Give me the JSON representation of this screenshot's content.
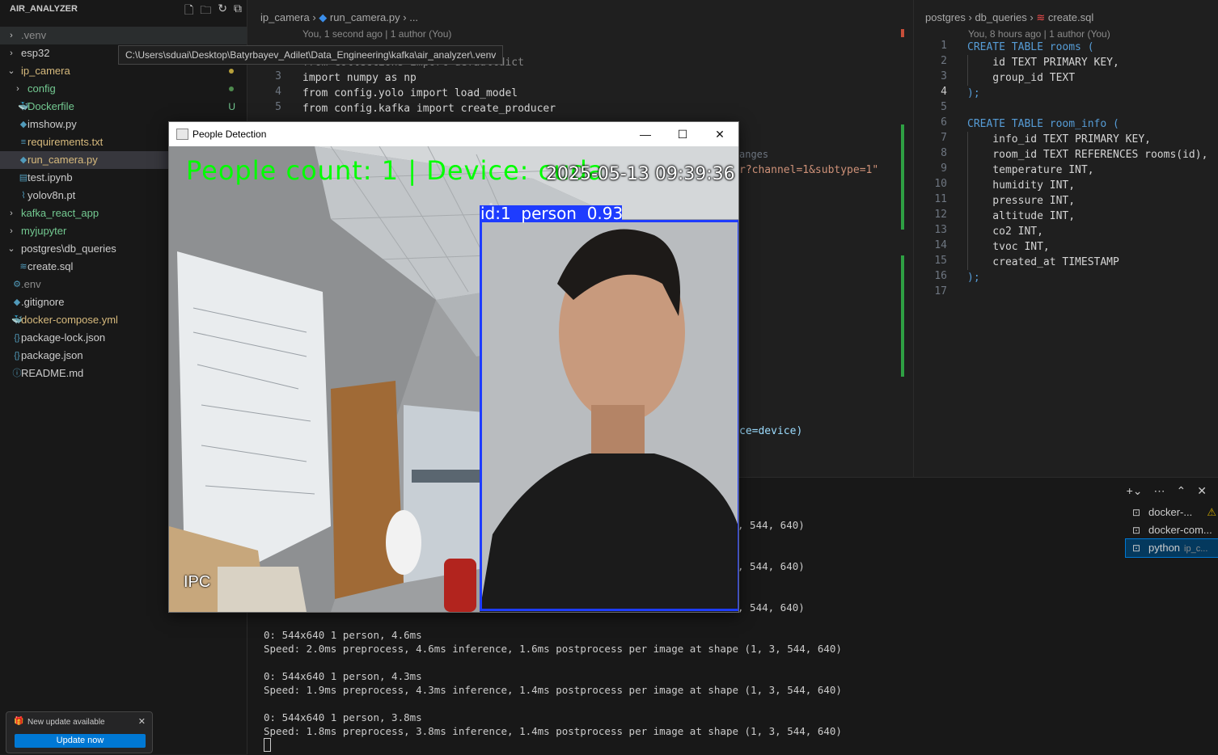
{
  "explorer": {
    "title": "AIR_ANALYZER",
    "tooltip": "C:\\Users\\sduai\\Desktop\\Batyrbayev_Adilet\\Data_Engineering\\kafka\\air_analyzer\\.venv",
    "items": [
      {
        "label": ".venv",
        "chev": "›",
        "icon": "",
        "badge": "",
        "color": "#8b8b8b"
      },
      {
        "label": "esp32",
        "chev": "›",
        "icon": "",
        "badge": "",
        "color": "#cccccc"
      },
      {
        "label": "ip_camera",
        "chev": "⌄",
        "icon": "",
        "badge": "",
        "color": "#d7ba7d"
      },
      {
        "label": "config",
        "chev": "›",
        "icon": "",
        "badge": "",
        "color": "#73c991"
      },
      {
        "label": "Dockerfile",
        "chev": "",
        "icon": "🐳",
        "badge": "U",
        "color": "#73c991"
      },
      {
        "label": "imshow.py",
        "chev": "",
        "icon": "◆",
        "badge": "",
        "color": "#cccccc"
      },
      {
        "label": "requirements.txt",
        "chev": "",
        "icon": "≡",
        "badge": "",
        "color": "#d7ba7d"
      },
      {
        "label": "run_camera.py",
        "chev": "",
        "icon": "◆",
        "badge": "",
        "color": "#d7ba7d"
      },
      {
        "label": "test.ipynb",
        "chev": "",
        "icon": "▤",
        "badge": "",
        "color": "#cccccc"
      },
      {
        "label": "yolov8n.pt",
        "chev": "",
        "icon": "⌇",
        "badge": "",
        "color": "#cccccc"
      },
      {
        "label": "kafka_react_app",
        "chev": "›",
        "icon": "",
        "badge": "",
        "color": "#73c991"
      },
      {
        "label": "myjupyter",
        "chev": "›",
        "icon": "",
        "badge": "",
        "color": "#73c991"
      },
      {
        "label": "postgres\\db_queries",
        "chev": "⌄",
        "icon": "",
        "badge": "",
        "color": "#cccccc"
      },
      {
        "label": "create.sql",
        "chev": "",
        "icon": "≋",
        "badge": "",
        "color": "#cccccc"
      },
      {
        "label": ".env",
        "chev": "",
        "icon": "⚙",
        "badge": "",
        "color": "#8b8b8b"
      },
      {
        "label": ".gitignore",
        "chev": "",
        "icon": "◆",
        "badge": "",
        "color": "#cccccc"
      },
      {
        "label": "docker-compose.yml",
        "chev": "",
        "icon": "🐳",
        "badge": "",
        "color": "#d7ba7d"
      },
      {
        "label": "package-lock.json",
        "chev": "",
        "icon": "{}",
        "badge": "",
        "color": "#cccccc"
      },
      {
        "label": "package.json",
        "chev": "",
        "icon": "{}",
        "badge": "",
        "color": "#cccccc"
      },
      {
        "label": "README.md",
        "chev": "",
        "icon": "ⓘ",
        "badge": "",
        "color": "#cccccc"
      }
    ]
  },
  "update_toast": {
    "title": "New update available",
    "button": "Update now"
  },
  "editor1": {
    "breadcrumb_folder": "ip_camera",
    "breadcrumb_file": "run_camera.py",
    "breadcrumb_more": "...",
    "blame": "You, 1 second ago | 1 author (You)",
    "lines": [
      {
        "n": "2",
        "text": "from collections import defaultdict"
      },
      {
        "n": "3",
        "text": "import numpy as np"
      },
      {
        "n": "4",
        "text": "from config.yolo import load_model"
      },
      {
        "n": "5",
        "text": "from config.kafka import create_producer"
      }
    ],
    "partial_hint": "anges",
    "partial_string": "r?channel=1&subtype=1\"",
    "partial_device": "ce=device)"
  },
  "editor2": {
    "breadcrumb_folder": "postgres",
    "breadcrumb_sub": "db_queries",
    "breadcrumb_file": "create.sql",
    "blame": "You, 8 hours ago | 1 author (You)",
    "lines": [
      {
        "n": "1",
        "text": "CREATE TABLE rooms ("
      },
      {
        "n": "2",
        "text": "    id TEXT PRIMARY KEY,"
      },
      {
        "n": "3",
        "text": "    group_id TEXT"
      },
      {
        "n": "4",
        "text": ");"
      },
      {
        "n": "5",
        "text": ""
      },
      {
        "n": "6",
        "text": "CREATE TABLE room_info ("
      },
      {
        "n": "7",
        "text": "    info_id TEXT PRIMARY KEY,"
      },
      {
        "n": "8",
        "text": "    room_id TEXT REFERENCES rooms(id),"
      },
      {
        "n": "9",
        "text": "    temperature INT,"
      },
      {
        "n": "10",
        "text": "    humidity INT,"
      },
      {
        "n": "11",
        "text": "    pressure INT,"
      },
      {
        "n": "12",
        "text": "    altitude INT,"
      },
      {
        "n": "13",
        "text": "    co2 INT,"
      },
      {
        "n": "14",
        "text": "    tvoc INT,"
      },
      {
        "n": "15",
        "text": "    created_at TIMESTAMP"
      },
      {
        "n": "16",
        "text": ");"
      },
      {
        "n": "17",
        "text": ""
      }
    ]
  },
  "terminal": {
    "partial_lines": [
      ", 544, 640)",
      ", 544, 640)",
      ", 544, 640)"
    ],
    "lines": [
      "0: 544x640 1 person, 4.6ms",
      "Speed: 2.0ms preprocess, 4.6ms inference, 1.6ms postprocess per image at shape (1, 3, 544, 640)",
      "",
      "0: 544x640 1 person, 4.3ms",
      "Speed: 1.9ms preprocess, 4.3ms inference, 1.4ms postprocess per image at shape (1, 3, 544, 640)",
      "",
      "0: 544x640 1 person, 3.8ms",
      "Speed: 1.8ms preprocess, 3.8ms inference, 1.4ms postprocess per image at shape (1, 3, 544, 640)"
    ],
    "tabs": [
      {
        "label": "docker-...",
        "warn": "⚠"
      },
      {
        "label": "docker-com..."
      },
      {
        "label": "python",
        "sub": "ip_c..."
      }
    ]
  },
  "window": {
    "title": "People Detection",
    "overlay_count": "People count: 1 | Device: cuda",
    "overlay_time": "2025-05-13 09:39:36",
    "overlay_bbox_label": "id:1  person  0.93",
    "overlay_corner": "IPC",
    "bbox": {
      "confidence": 0.93,
      "track_id": 1,
      "class": "person"
    }
  },
  "colors": {
    "accent": "#0078d4",
    "bbox": "#1e3cff",
    "overlay_green": "#00ff00"
  }
}
